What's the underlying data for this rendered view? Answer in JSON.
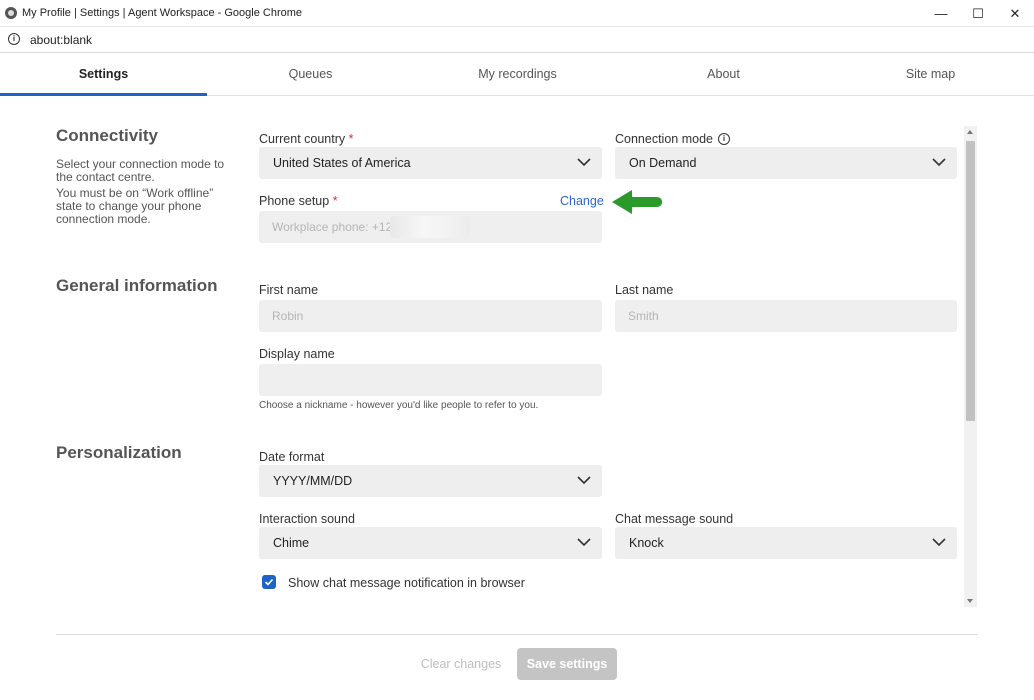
{
  "window": {
    "title": "My Profile | Settings | Agent Workspace - Google Chrome",
    "minimize": "—",
    "maximize": "☐",
    "close": "✕"
  },
  "address": {
    "url": "about:blank"
  },
  "tabs": [
    {
      "label": "Settings",
      "active": true
    },
    {
      "label": "Queues"
    },
    {
      "label": "My recordings"
    },
    {
      "label": "About"
    },
    {
      "label": "Site map"
    }
  ],
  "connectivity": {
    "title": "Connectivity",
    "desc1": "Select your connection mode to the contact centre.",
    "desc2": "You must be on “Work offline” state to change your phone connection mode.",
    "country_label": "Current country",
    "country_value": "United States of America",
    "mode_label": "Connection mode",
    "mode_value": "On Demand",
    "phone_label": "Phone setup",
    "phone_change": "Change",
    "phone_placeholder": "Workplace phone: +12",
    "required_mark": "*"
  },
  "general": {
    "title": "General information",
    "first_label": "First name",
    "first_placeholder": "Robin",
    "last_label": "Last name",
    "last_placeholder": "Smith",
    "display_label": "Display name",
    "display_hint": "Choose a nickname - however you'd like people to refer to you."
  },
  "personalization": {
    "title": "Personalization",
    "date_label": "Date format",
    "date_value": "YYYY/MM/DD",
    "sound_label": "Interaction sound",
    "sound_value": "Chime",
    "chat_label": "Chat message sound",
    "chat_value": "Knock",
    "notify_label": "Show chat message notification in browser",
    "notify_checked": true
  },
  "footer": {
    "clear": "Clear changes",
    "save": "Save settings"
  },
  "colors": {
    "accent": "#1f63c7",
    "arrow": "#2a9a2a",
    "required": "#d0303a",
    "link": "#2b66c9"
  }
}
